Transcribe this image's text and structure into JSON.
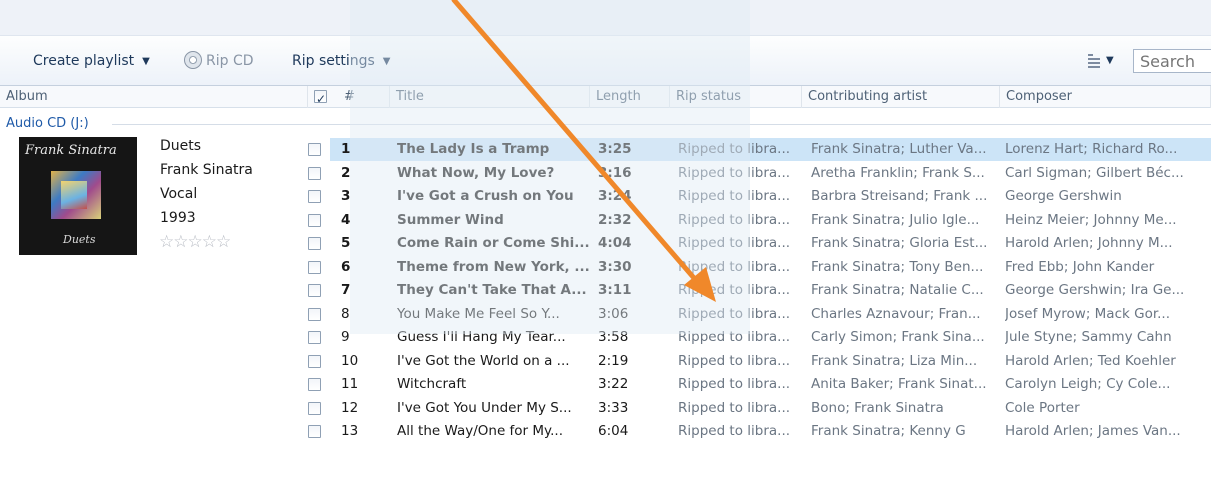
{
  "toolbar": {
    "create_playlist": "Create playlist",
    "rip_cd": "Rip CD",
    "rip_settings": "Rip settings",
    "search_placeholder": "Search"
  },
  "columns": {
    "album": "Album",
    "num": "#",
    "title": "Title",
    "length": "Length",
    "rip_status": "Rip status",
    "contributing_artist": "Contributing artist",
    "composer": "Composer"
  },
  "group": {
    "label": "Audio CD (J:)"
  },
  "album": {
    "title": "Duets",
    "artist": "Frank Sinatra",
    "genre": "Vocal",
    "year": "1993",
    "rating": "☆☆☆☆☆",
    "cover_signature": "Frank Sinatra",
    "cover_title": "Duets"
  },
  "tracks": [
    {
      "num": "1",
      "title": "The Lady Is a Tramp",
      "length": "3:25",
      "rip": "Ripped to libra...",
      "artist": "Frank Sinatra;  Luther Va...",
      "composer": "Lorenz Hart; Richard Ro..."
    },
    {
      "num": "2",
      "title": "What Now, My Love?",
      "length": "3:16",
      "rip": "Ripped to libra...",
      "artist": "Aretha Franklin;  Frank S...",
      "composer": "Carl Sigman; Gilbert Béc..."
    },
    {
      "num": "3",
      "title": "I've Got a Crush on You",
      "length": "3:24",
      "rip": "Ripped to libra...",
      "artist": "Barbra Streisand;  Frank ...",
      "composer": "George Gershwin"
    },
    {
      "num": "4",
      "title": "Summer Wind",
      "length": "2:32",
      "rip": "Ripped to libra...",
      "artist": "Frank Sinatra;  Julio Igle...",
      "composer": "Heinz Meier; Johnny Me..."
    },
    {
      "num": "5",
      "title": "Come Rain or Come Shi...",
      "length": "4:04",
      "rip": "Ripped to libra...",
      "artist": "Frank Sinatra;  Gloria Est...",
      "composer": "Harold Arlen; Johnny M..."
    },
    {
      "num": "6",
      "title": "Theme from New York, ...",
      "length": "3:30",
      "rip": "Ripped to libra...",
      "artist": "Frank Sinatra;  Tony Ben...",
      "composer": "Fred Ebb; John Kander"
    },
    {
      "num": "7",
      "title": "They Can't Take That A...",
      "length": "3:11",
      "rip": "Ripped to libra...",
      "artist": "Frank Sinatra;  Natalie C...",
      "composer": "George Gershwin; Ira Ge..."
    },
    {
      "num": "8",
      "title": "You Make Me Feel So Y...",
      "length": "3:06",
      "rip": "Ripped to libra...",
      "artist": "Charles Aznavour;  Fran...",
      "composer": "Josef Myrow; Mack Gor..."
    },
    {
      "num": "9",
      "title": "Guess I'll Hang My Tear...",
      "length": "3:58",
      "rip": "Ripped to libra...",
      "artist": "Carly Simon;  Frank Sina...",
      "composer": "Jule Styne; Sammy Cahn"
    },
    {
      "num": "10",
      "title": "I've Got the World on a ...",
      "length": "2:19",
      "rip": "Ripped to libra...",
      "artist": "Frank Sinatra;  Liza Min...",
      "composer": "Harold Arlen; Ted Koehler"
    },
    {
      "num": "11",
      "title": "Witchcraft",
      "length": "3:22",
      "rip": "Ripped to libra...",
      "artist": "Anita Baker;  Frank Sinat...",
      "composer": "Carolyn Leigh; Cy Cole..."
    },
    {
      "num": "12",
      "title": "I've Got You Under My S...",
      "length": "3:33",
      "rip": "Ripped to libra...",
      "artist": "Bono;  Frank Sinatra",
      "composer": "Cole Porter"
    },
    {
      "num": "13",
      "title": "All the Way/One for My...",
      "length": "6:04",
      "rip": "Ripped to libra...",
      "artist": "Frank Sinatra;  Kenny G",
      "composer": "Harold Arlen; James Van..."
    }
  ],
  "colors": {
    "accent": "#1f5aa8",
    "selection": "#cce4f7",
    "arrow": "#f0882a"
  }
}
